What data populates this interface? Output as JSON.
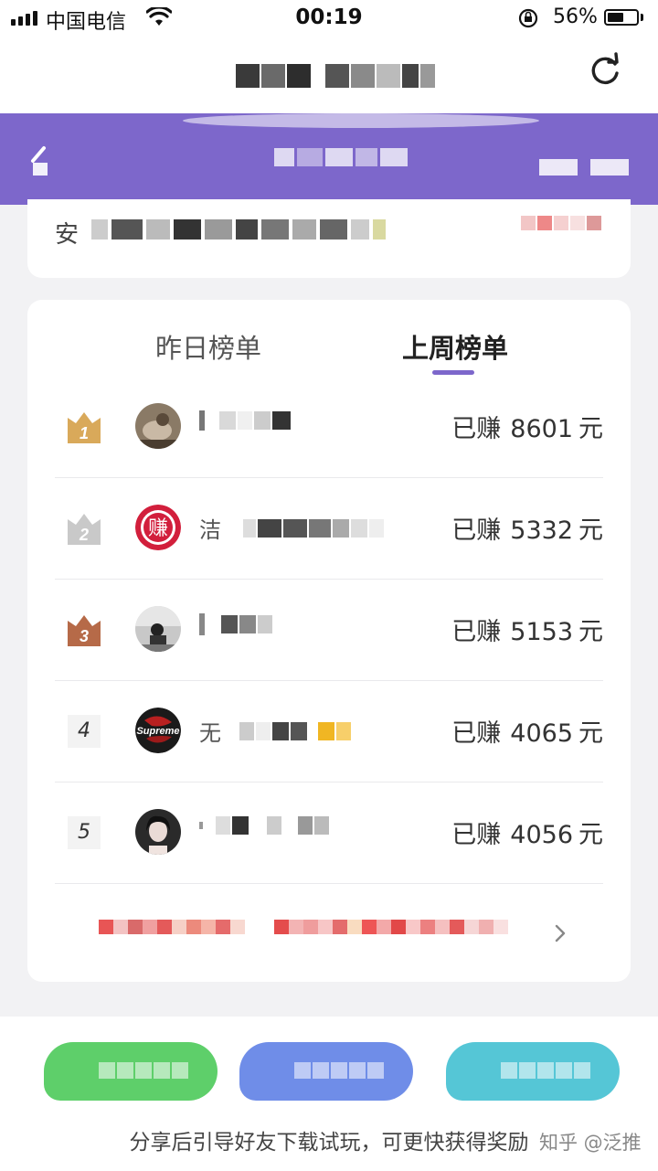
{
  "status_bar": {
    "carrier": "中国电信",
    "time": "00:19",
    "battery_percent": "56%",
    "battery_level": 0.56
  },
  "nav": {
    "refresh_icon": "refresh-icon"
  },
  "notice": {
    "prefix": "安"
  },
  "tabs": [
    {
      "label": "昨日榜单",
      "active": false
    },
    {
      "label": "上周榜单",
      "active": true
    }
  ],
  "ranking": [
    {
      "rank": "1",
      "prefix": "已赚",
      "amount": "8601",
      "unit": "元",
      "name_initial": ""
    },
    {
      "rank": "2",
      "prefix": "已赚",
      "amount": "5332",
      "unit": "元",
      "name_initial": "洁"
    },
    {
      "rank": "3",
      "prefix": "已赚",
      "amount": "5153",
      "unit": "元",
      "name_initial": ""
    },
    {
      "rank": "4",
      "prefix": "已赚",
      "amount": "4065",
      "unit": "元",
      "name_initial": "无"
    },
    {
      "rank": "5",
      "prefix": "已赚",
      "amount": "4056",
      "unit": "元",
      "name_initial": ""
    }
  ],
  "avatar_texts": {
    "rank2": "赚",
    "rank4": "Supreme"
  },
  "share_hint": "分享后引导好友下载试玩，可更快获得奖励",
  "watermark": "知乎 @泛推",
  "colors": {
    "accent": "#7d67cb",
    "gold": "#d9a95a",
    "silver": "#c9c9c9",
    "bronze": "#b66a48"
  }
}
